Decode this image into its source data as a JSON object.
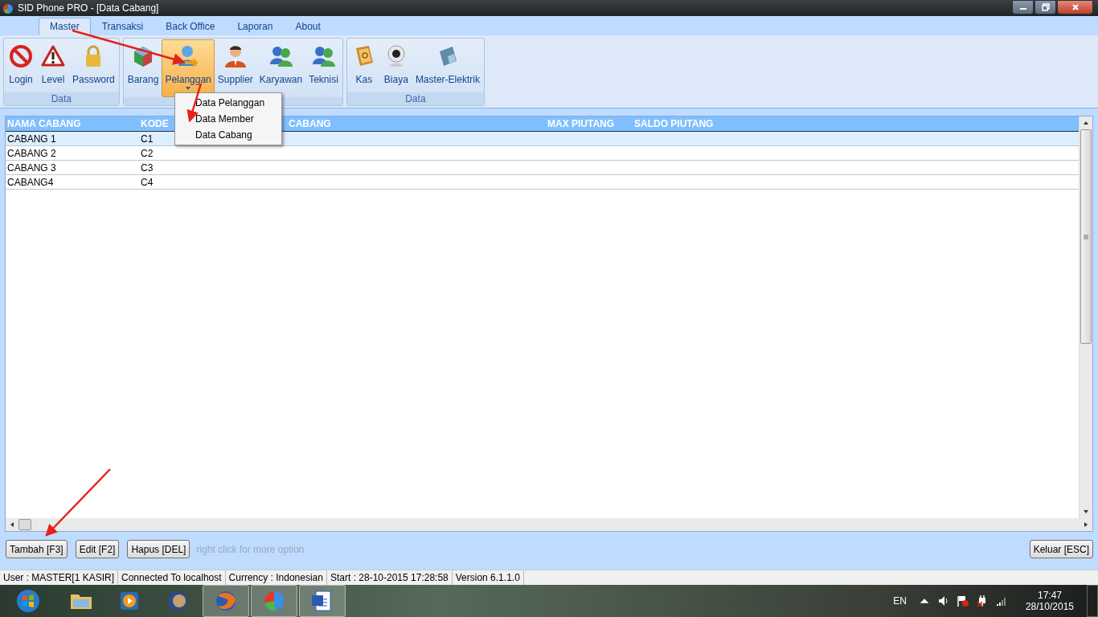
{
  "window": {
    "title": "SID Phone PRO - [Data Cabang]"
  },
  "ribbon_tabs": [
    {
      "label": "Master",
      "selected": true
    },
    {
      "label": "Transaksi",
      "selected": false
    },
    {
      "label": "Back Office",
      "selected": false
    },
    {
      "label": "Laporan",
      "selected": false
    },
    {
      "label": "About",
      "selected": false
    }
  ],
  "ribbon_groups": [
    {
      "label": "Data",
      "buttons": [
        {
          "label": "Login",
          "pressed": false
        },
        {
          "label": "Level",
          "pressed": false
        },
        {
          "label": "Password",
          "pressed": false
        }
      ]
    },
    {
      "buttons": [
        {
          "label": "Barang",
          "pressed": false
        },
        {
          "label": "Pelanggan",
          "pressed": true,
          "dropdown": true
        },
        {
          "label": "Supplier",
          "pressed": false
        },
        {
          "label": "Karyawan",
          "pressed": false
        },
        {
          "label": "Teknisi",
          "pressed": false
        }
      ]
    },
    {
      "label": "Data",
      "buttons": [
        {
          "label": "Kas",
          "pressed": false
        },
        {
          "label": "Biaya",
          "pressed": false
        },
        {
          "label": "Master-Elektrik",
          "pressed": false
        }
      ]
    }
  ],
  "dropdown_menu": {
    "items": [
      "Data Pelanggan",
      "Data Member",
      "Data Cabang"
    ]
  },
  "table": {
    "columns": [
      "NAMA CABANG",
      "KODE",
      "CABANG",
      "MAX PIUTANG",
      "SALDO PIUTANG"
    ],
    "rows": [
      {
        "cells": [
          "CABANG 1",
          "C1"
        ],
        "selected": true
      },
      {
        "cells": [
          "CABANG 2",
          "C2"
        ],
        "selected": false
      },
      {
        "cells": [
          "CABANG 3",
          "C3"
        ],
        "selected": false
      },
      {
        "cells": [
          "CABANG4",
          "C4"
        ],
        "selected": false
      }
    ]
  },
  "buttons": [
    "Tambah [F3]",
    "Edit [F2]",
    "Hapus [DEL]"
  ],
  "hint": "right click for more option",
  "exit_button": "Keluar [ESC]",
  "status_bar": [
    "User : MASTER[1 KASIR]",
    "Connected To localhost",
    "Currency : Indonesian",
    "Start  : 28-10-2015 17:28:58",
    "Version 6.1.1.0"
  ],
  "taskbar": {
    "apps": [
      {
        "open": false
      },
      {
        "open": false
      },
      {
        "open": false
      },
      {
        "open": true
      },
      {
        "open": true
      },
      {
        "open": true
      }
    ],
    "language": "EN",
    "time": "17:47",
    "date": "28/10/2015"
  }
}
